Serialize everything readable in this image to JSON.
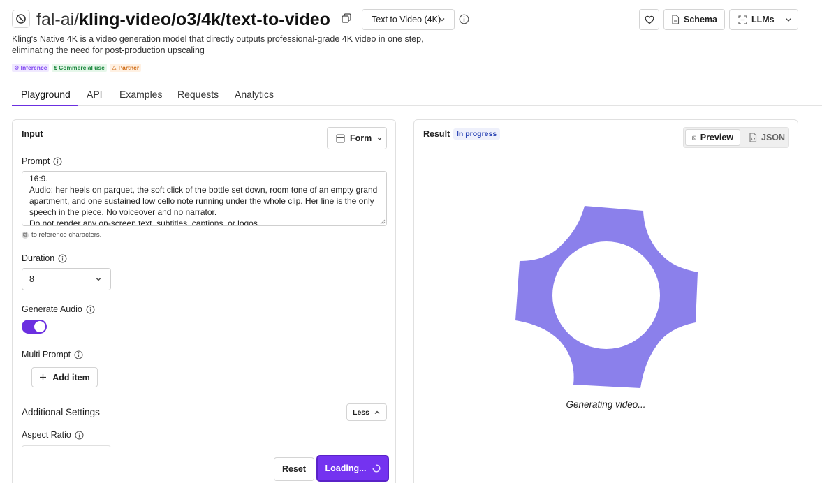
{
  "header": {
    "namespace": "fal-ai/",
    "model_path": "kling-video/o3/4k/text-to-video",
    "mode_select": "Text to Video (4K)",
    "schema_label": "Schema",
    "llms_label": "LLMs",
    "description": "Kling's Native 4K is a video generation model that directly outputs professional-grade 4K video in one step, eliminating the need for post-production upscaling",
    "badges": [
      "Inference",
      "Commercial use",
      "Partner"
    ]
  },
  "tabs": [
    "Playground",
    "API",
    "Examples",
    "Requests",
    "Analytics"
  ],
  "input": {
    "title": "Input",
    "form_label": "Form",
    "prompt_label": "Prompt",
    "prompt_lines": [
      "16:9.",
      "Audio: her heels on parquet, the soft click of the bottle set down, room tone of an empty grand apartment, and one sustained low cello note running under the whole clip. Her line is the only speech in the piece. No voiceover and no narrator.",
      "Do not render any on-screen text, subtitles, captions, or logos."
    ],
    "ref_hint": "to reference characters.",
    "duration_label": "Duration",
    "duration_value": "8",
    "generate_audio_label": "Generate Audio",
    "generate_audio_on": true,
    "multi_prompt_label": "Multi Prompt",
    "add_item_label": "Add item",
    "additional_settings_label": "Additional Settings",
    "less_label": "Less",
    "aspect_ratio_label": "Aspect Ratio",
    "reset_label": "Reset",
    "submit_label": "Loading..."
  },
  "result": {
    "title": "Result",
    "status": "In progress",
    "preview_label": "Preview",
    "json_label": "JSON",
    "generating_text": "Generating video..."
  },
  "colors": {
    "accent": "#7433f0",
    "spinner_shape": "#8b80eb",
    "status_badge_bg": "#eef0fb",
    "status_badge_text": "#2f48b5"
  }
}
